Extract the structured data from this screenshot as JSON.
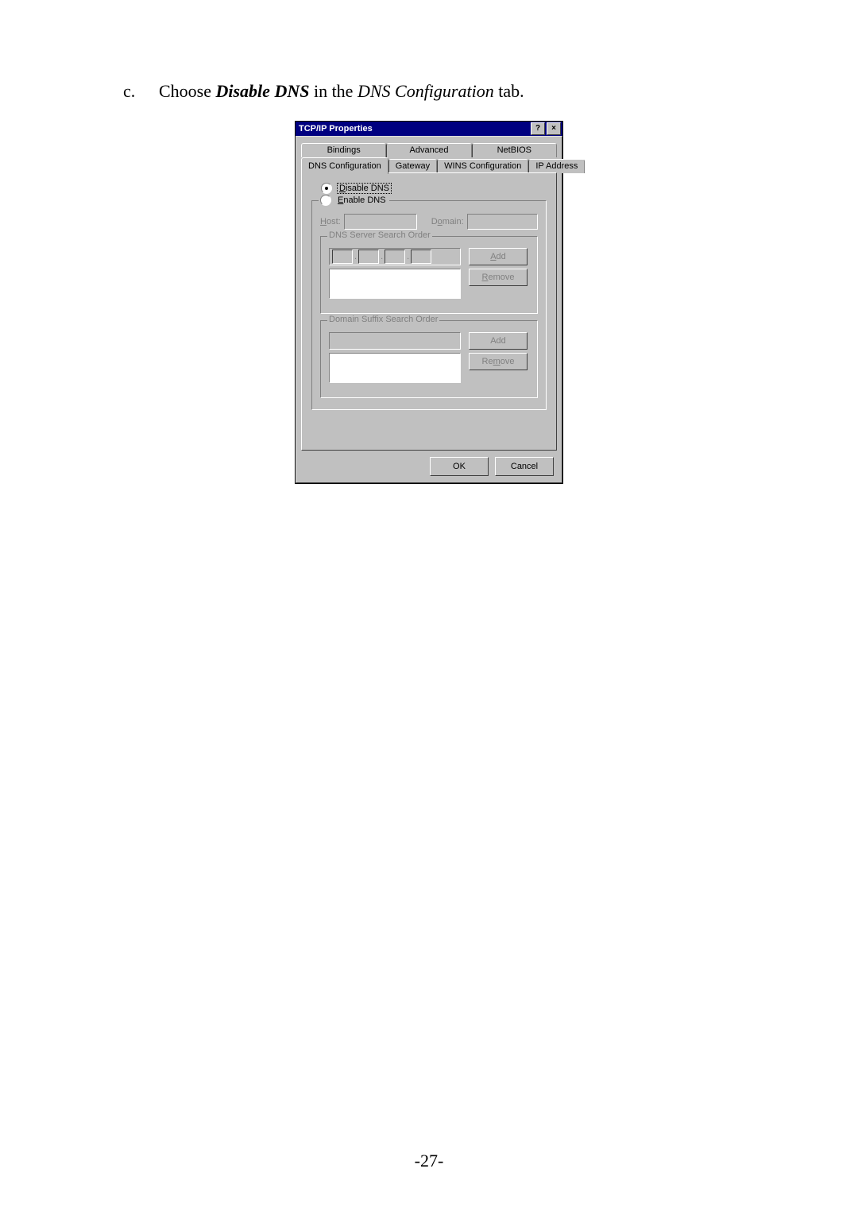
{
  "instruction": {
    "letter": "c.",
    "prefix": "Choose ",
    "bold": "Disable DNS",
    "mid": " in the ",
    "italic": "DNS Configuration",
    "suffix": " tab."
  },
  "dialog": {
    "title": "TCP/IP Properties",
    "help": "?",
    "close": "×",
    "tabs_row1": [
      "Bindings",
      "Advanced",
      "NetBIOS"
    ],
    "tabs_row2": [
      "DNS Configuration",
      "Gateway",
      "WINS Configuration",
      "IP Address"
    ],
    "active_tab": "DNS Configuration",
    "radio_disable": "Disable DNS",
    "radio_enable": "Enable DNS",
    "radio_selected": "disable",
    "host_label": "Host:",
    "domain_label": "Domain:",
    "group_dns_servers": "DNS Server Search Order",
    "group_domain_suffix": "Domain Suffix Search Order",
    "btn_add": "Add",
    "btn_remove": "Remove",
    "btn_ok": "OK",
    "btn_cancel": "Cancel"
  },
  "page_number": "-27-"
}
